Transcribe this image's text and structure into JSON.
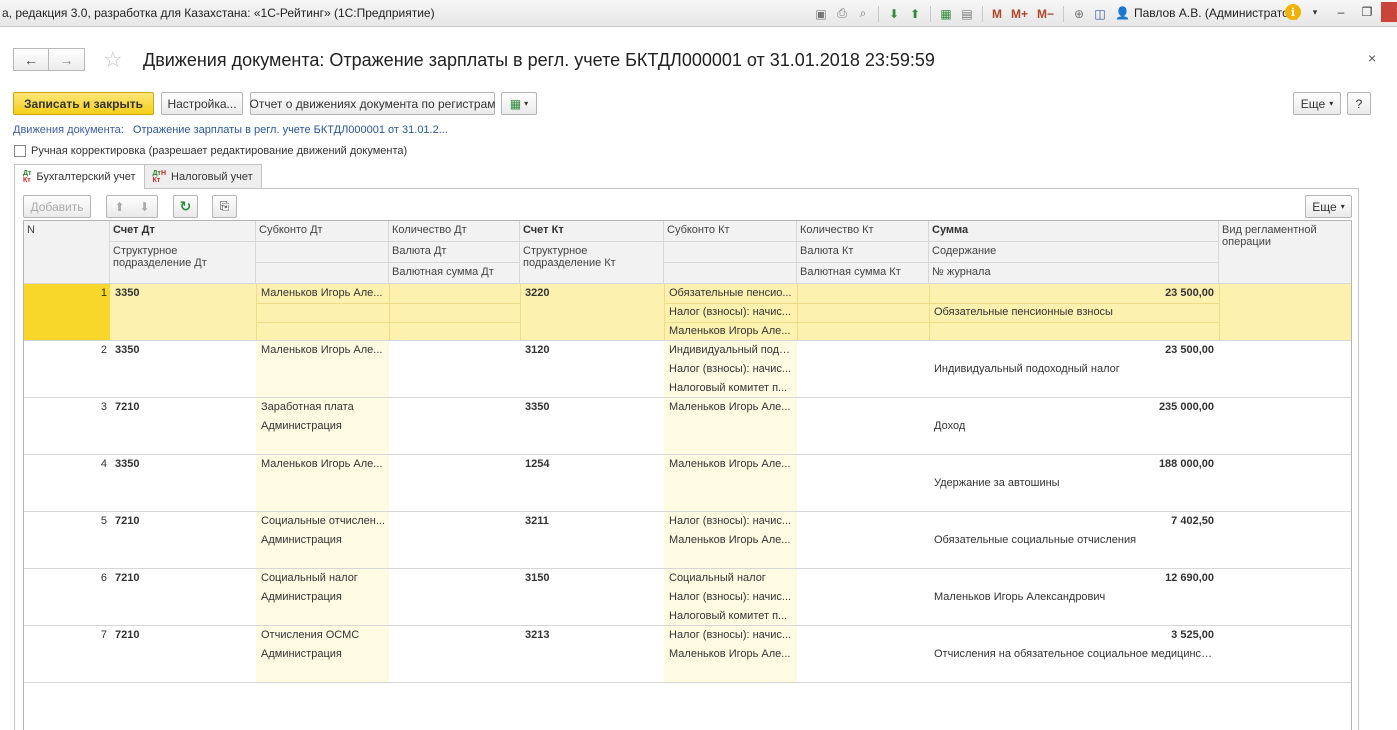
{
  "window": {
    "title": "а, редакция 3.0, разработка для Казахстана: «1С-Рейтинг»  (1С:Предприятие)",
    "user": "Павлов А.В. (Администратор)",
    "toolbar_icons": [
      "save-icon",
      "print-icon",
      "preview-icon",
      "download-icon",
      "upload-icon",
      "calculator-icon",
      "calendar-icon"
    ],
    "m_buttons": [
      "M",
      "M+",
      "M−"
    ]
  },
  "form": {
    "title": "Движения документа: Отражение зарплаты в регл. учете БКТДЛ000001 от 31.01.2018 23:59:59",
    "nav_back": "←",
    "nav_forward": "→",
    "close": "×"
  },
  "commands": {
    "write_close": "Записать и закрыть",
    "settings": "Настройка...",
    "report": "Отчет о движениях документа по регистрам",
    "more": "Еще",
    "help": "?"
  },
  "link": {
    "label": "Движения документа:",
    "value": "Отражение зарплаты в регл. учете БКТДЛ000001 от 31.01.2..."
  },
  "manual": {
    "label": "Ручная корректировка (разрешает редактирование движений документа)"
  },
  "tabs": [
    {
      "label": "Бухгалтерский учет",
      "icon_dt": "Дт",
      "icon_kt": "Кт"
    },
    {
      "label": "Налоговый учет",
      "icon_dt": "Дт",
      "icon_kt": "Кт",
      "sup": "Н"
    }
  ],
  "grid_commands": {
    "add": "Добавить",
    "more": "Еще"
  },
  "columns": {
    "n": "N",
    "account_dt": "Счет Дт",
    "subdiv_dt": "Структурное подразделение Дт",
    "subconto_dt": "Субконто Дт",
    "qty_dt": "Количество Дт",
    "currency_dt": "Валюта Дт",
    "cur_sum_dt": "Валютная сумма Дт",
    "account_kt": "Счет Кт",
    "subdiv_kt": "Структурное подразделение Кт",
    "subconto_kt": "Субконто Кт",
    "qty_kt": "Количество Кт",
    "currency_kt": "Валюта Кт",
    "cur_sum_kt": "Валютная сумма Кт",
    "sum": "Сумма",
    "content": "Содержание",
    "journal": "№ журнала",
    "op_type": "Вид регламентной операции"
  },
  "rows": [
    {
      "n": "1",
      "account_dt": "3350",
      "subdiv_dt": "",
      "subconto_dt": [
        "Маленьков Игорь Але...",
        "",
        ""
      ],
      "account_kt": "3220",
      "subconto_kt": [
        "Обязательные пенсио...",
        "Налог (взносы): начис...",
        "Маленьков Игорь Але..."
      ],
      "sum": "23 500,00",
      "content": "Обязательные пенсионные взносы"
    },
    {
      "n": "2",
      "account_dt": "3350",
      "subdiv_dt": "",
      "subconto_dt": [
        "Маленьков Игорь Але...",
        "",
        ""
      ],
      "account_kt": "3120",
      "subconto_kt": [
        "Индивидуальный подо...",
        "Налог (взносы): начис...",
        "Налоговый комитет п..."
      ],
      "sum": "23 500,00",
      "content": "Индивидуальный подоходный налог"
    },
    {
      "n": "3",
      "account_dt": "7210",
      "subdiv_dt": "",
      "subconto_dt": [
        "Заработная плата",
        "Администрация",
        ""
      ],
      "account_kt": "3350",
      "subconto_kt": [
        "Маленьков Игорь Але...",
        "",
        ""
      ],
      "sum": "235 000,00",
      "content": "Доход"
    },
    {
      "n": "4",
      "account_dt": "3350",
      "subdiv_dt": "",
      "subconto_dt": [
        "Маленьков Игорь Але...",
        "",
        ""
      ],
      "account_kt": "1254",
      "subconto_kt": [
        "Маленьков Игорь Але...",
        "",
        ""
      ],
      "sum": "188 000,00",
      "content": "Удержание за автошины"
    },
    {
      "n": "5",
      "account_dt": "7210",
      "subdiv_dt": "",
      "subconto_dt": [
        "Социальные отчислен...",
        "Администрация",
        ""
      ],
      "account_kt": "3211",
      "subconto_kt": [
        "Налог (взносы): начис...",
        "Маленьков Игорь Але...",
        ""
      ],
      "sum": "7 402,50",
      "content": "Обязательные социальные отчисления"
    },
    {
      "n": "6",
      "account_dt": "7210",
      "subdiv_dt": "",
      "subconto_dt": [
        "Социальный налог",
        "Администрация",
        ""
      ],
      "account_kt": "3150",
      "subconto_kt": [
        "Социальный налог",
        "Налог (взносы): начис...",
        "Налоговый комитет п..."
      ],
      "sum": "12 690,00",
      "content": "Маленьков Игорь Александрович"
    },
    {
      "n": "7",
      "account_dt": "7210",
      "subdiv_dt": "",
      "subconto_dt": [
        "Отчисления ОСМС",
        "Администрация",
        ""
      ],
      "account_kt": "3213",
      "subconto_kt": [
        "Налог (взносы): начис...",
        "Маленьков Игорь Але...",
        ""
      ],
      "sum": "3 525,00",
      "content": "Отчисления на обязательное социальное медицинск..."
    }
  ],
  "colors": {
    "selected_row": "#fdf1b0",
    "selected_n": "#f9d62a",
    "editable_col": "#fffbe3",
    "primary_button": "#f5cf1a",
    "link": "#2b5797"
  }
}
